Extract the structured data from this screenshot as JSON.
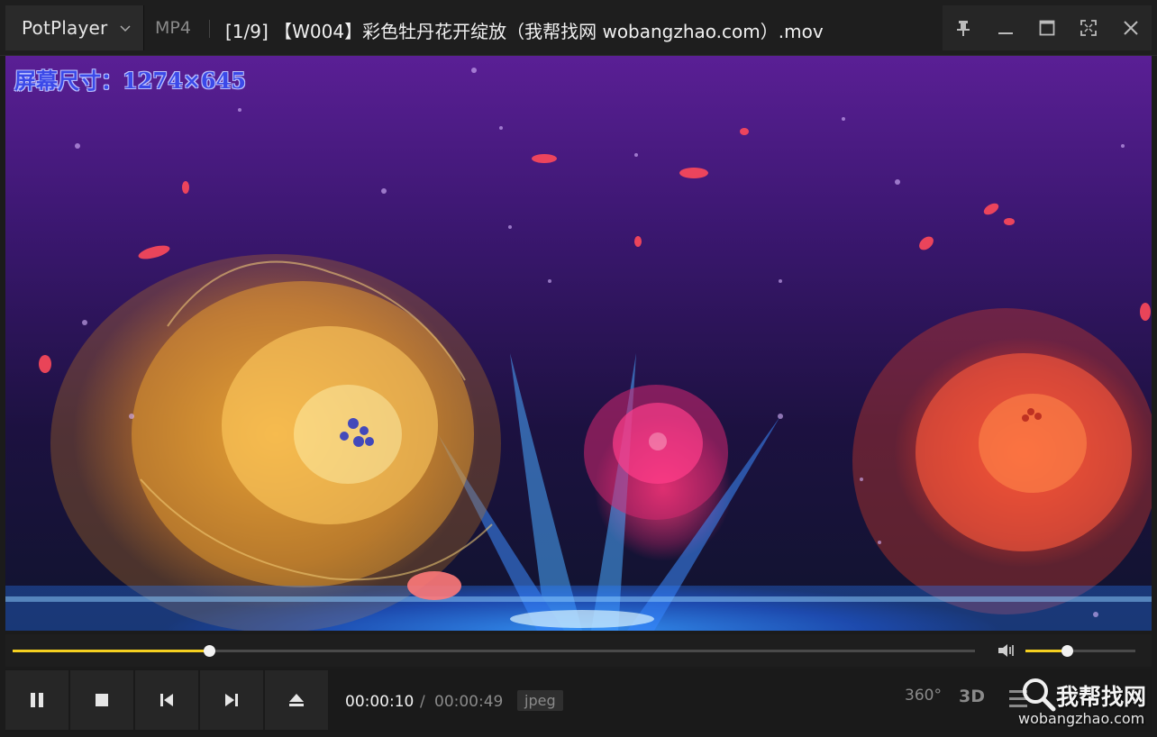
{
  "titlebar": {
    "app_name": "PotPlayer",
    "format": "MP4",
    "title": "[1/9] 【W004】彩色牡丹花开绽放（我帮找网 wobangzhao.com）.mov"
  },
  "video": {
    "osd_text": "屏幕尺寸：1274×645"
  },
  "seek": {
    "progress": 0.2041
  },
  "volume": {
    "level": 0.38
  },
  "controls": {
    "time_current": "00:00:10",
    "time_separator": "/",
    "time_total": "00:00:49",
    "codec": "jpeg",
    "btn_360": "360°",
    "btn_3d": "3D"
  },
  "watermark": {
    "name": "我帮找网",
    "url": "wobangzhao.com"
  },
  "colors": {
    "accent": "#f5d020",
    "osd": "#3b49e8"
  }
}
